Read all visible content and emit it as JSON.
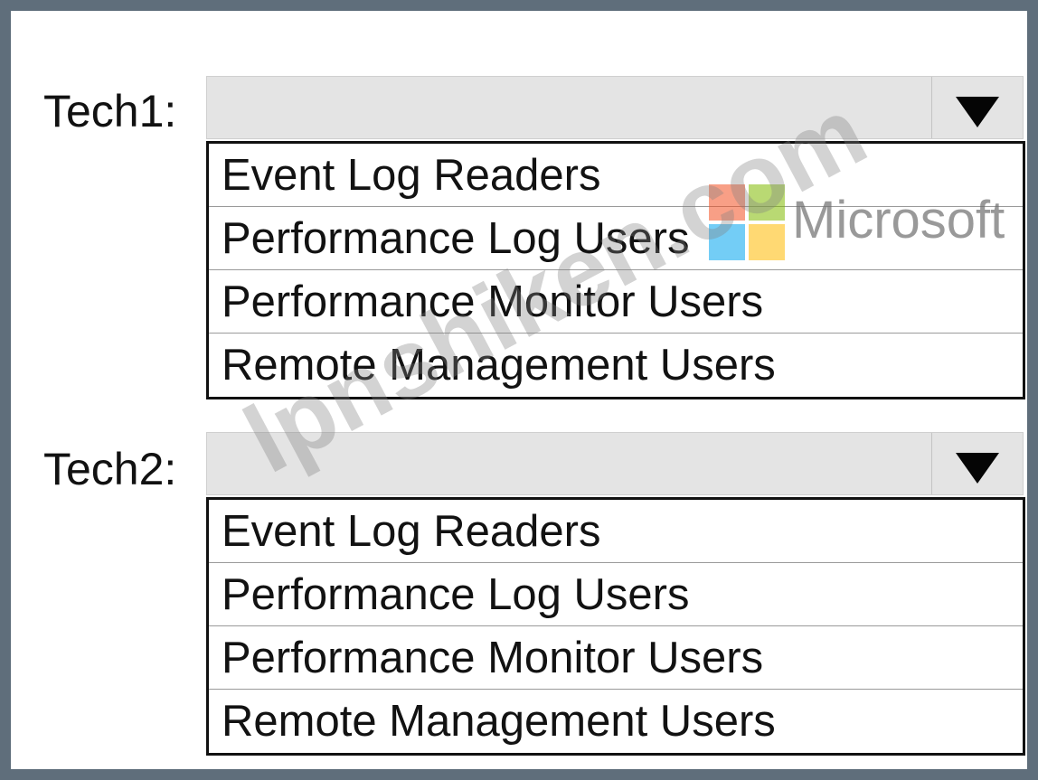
{
  "tech1": {
    "label": "Tech1:",
    "options": [
      "Event Log Readers",
      "Performance Log Users",
      "Performance Monitor Users",
      "Remote Management Users"
    ]
  },
  "tech2": {
    "label": "Tech2:",
    "options": [
      "Event Log Readers",
      "Performance Log Users",
      "Performance Monitor Users",
      "Remote Management Users"
    ]
  },
  "watermark": {
    "text": "lpnshiken.com",
    "brand": "Microsoft",
    "logo_colors": [
      "#f25022",
      "#7fba00",
      "#00a4ef",
      "#ffb900"
    ]
  },
  "colors": {
    "frame": "#5f6e7b",
    "dropdown_bg": "#e4e4e4"
  }
}
